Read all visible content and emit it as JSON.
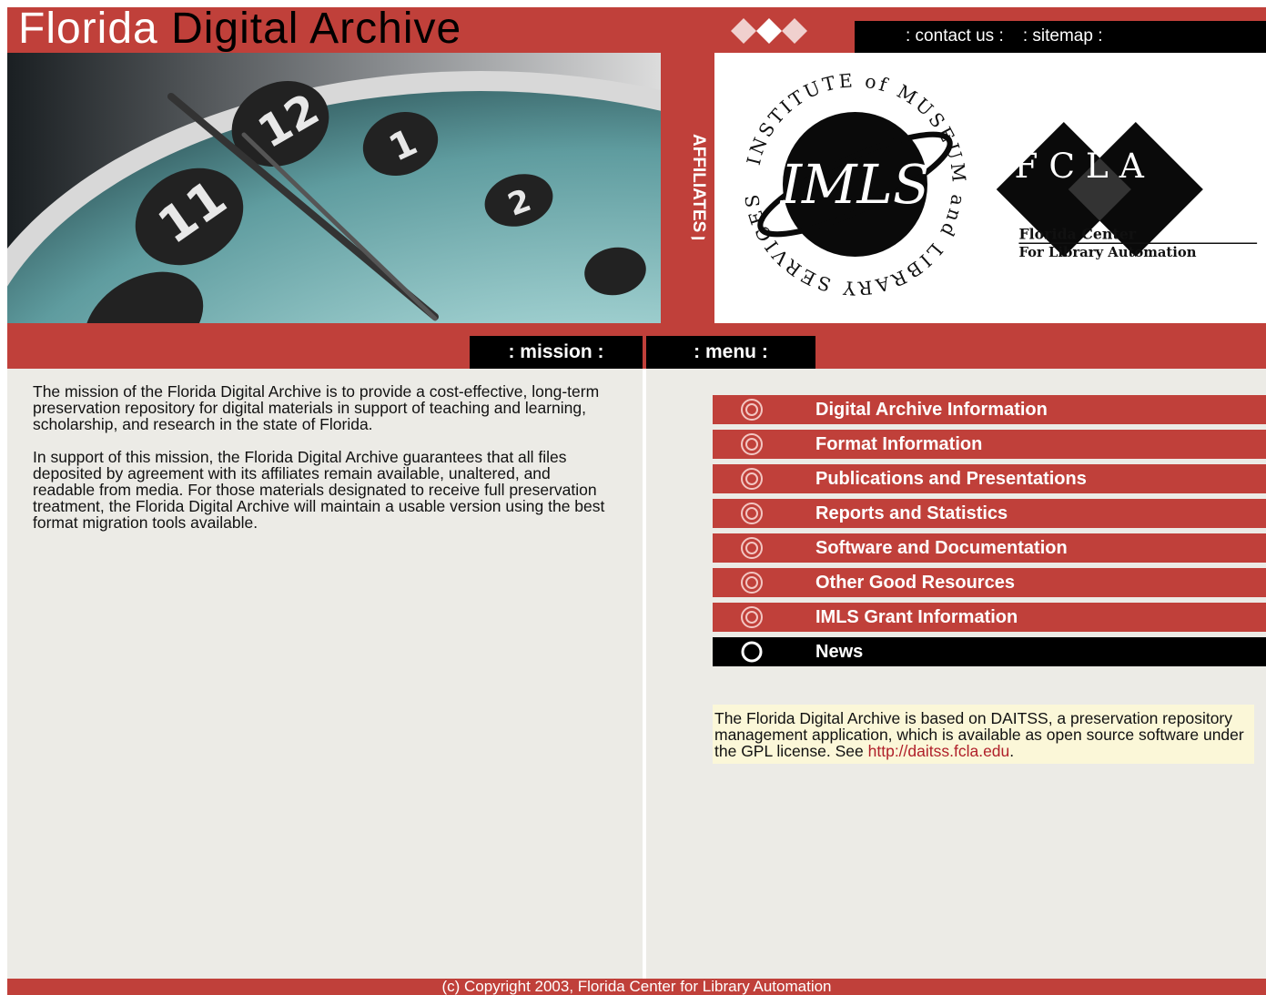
{
  "header": {
    "title_part1": "Florida",
    "title_part2": "Digital Archive",
    "nav": {
      "contact_label": ": contact us :",
      "sitemap_label": ": sitemap :"
    }
  },
  "affiliates": {
    "label": "AFFILIATES ▶",
    "imls_ring_text": "INSTITUTE of MUSEUM and LIBRARY SERVICES",
    "imls_mark": "IMLS",
    "fcla_mark": "FCLA",
    "fcla_line1": "Florida Center",
    "fcla_line2": "For Library Automation"
  },
  "tabs": {
    "mission": ": mission :",
    "menu": ": menu :"
  },
  "mission": {
    "paragraph1": "The mission of the Florida Digital Archive is to provide a cost-effective, long-term preservation repository for digital materials in support of teaching and learning, scholarship, and research in the state of Florida.",
    "paragraph2": "In support of this mission, the Florida Digital Archive guarantees that all files deposited by agreement with its affiliates remain available, unaltered, and readable from media. For those materials designated to receive full preservation treatment, the Florida Digital Archive will maintain a usable version using the best format migration tools available."
  },
  "menu": {
    "items": [
      {
        "label": "Digital Archive Information",
        "icon": "target-bullet-icon"
      },
      {
        "label": "Format Information",
        "icon": "target-bullet-icon"
      },
      {
        "label": "Publications and Presentations",
        "icon": "target-bullet-icon"
      },
      {
        "label": "Reports and Statistics",
        "icon": "target-bullet-icon"
      },
      {
        "label": "Software and Documentation",
        "icon": "target-bullet-icon"
      },
      {
        "label": "Other Good Resources",
        "icon": "target-bullet-icon"
      },
      {
        "label": "IMLS Grant Information",
        "icon": "target-bullet-icon"
      },
      {
        "label": "News",
        "icon": "ring-bullet-icon",
        "active": true
      }
    ]
  },
  "info": {
    "text": "The Florida Digital Archive is based on DAITSS, a preservation repository management application, which is available as open source software under the GPL license. See ",
    "link": "http://daitss.fcla.edu",
    "trailing": "."
  },
  "footer": {
    "copyright": "(c) Copyright 2003, Florida Center for Library Automation"
  },
  "colors": {
    "brand_red": "#c0403a",
    "black": "#000000",
    "page_bg": "#ecebe6",
    "info_bg": "#fbf7d8"
  }
}
